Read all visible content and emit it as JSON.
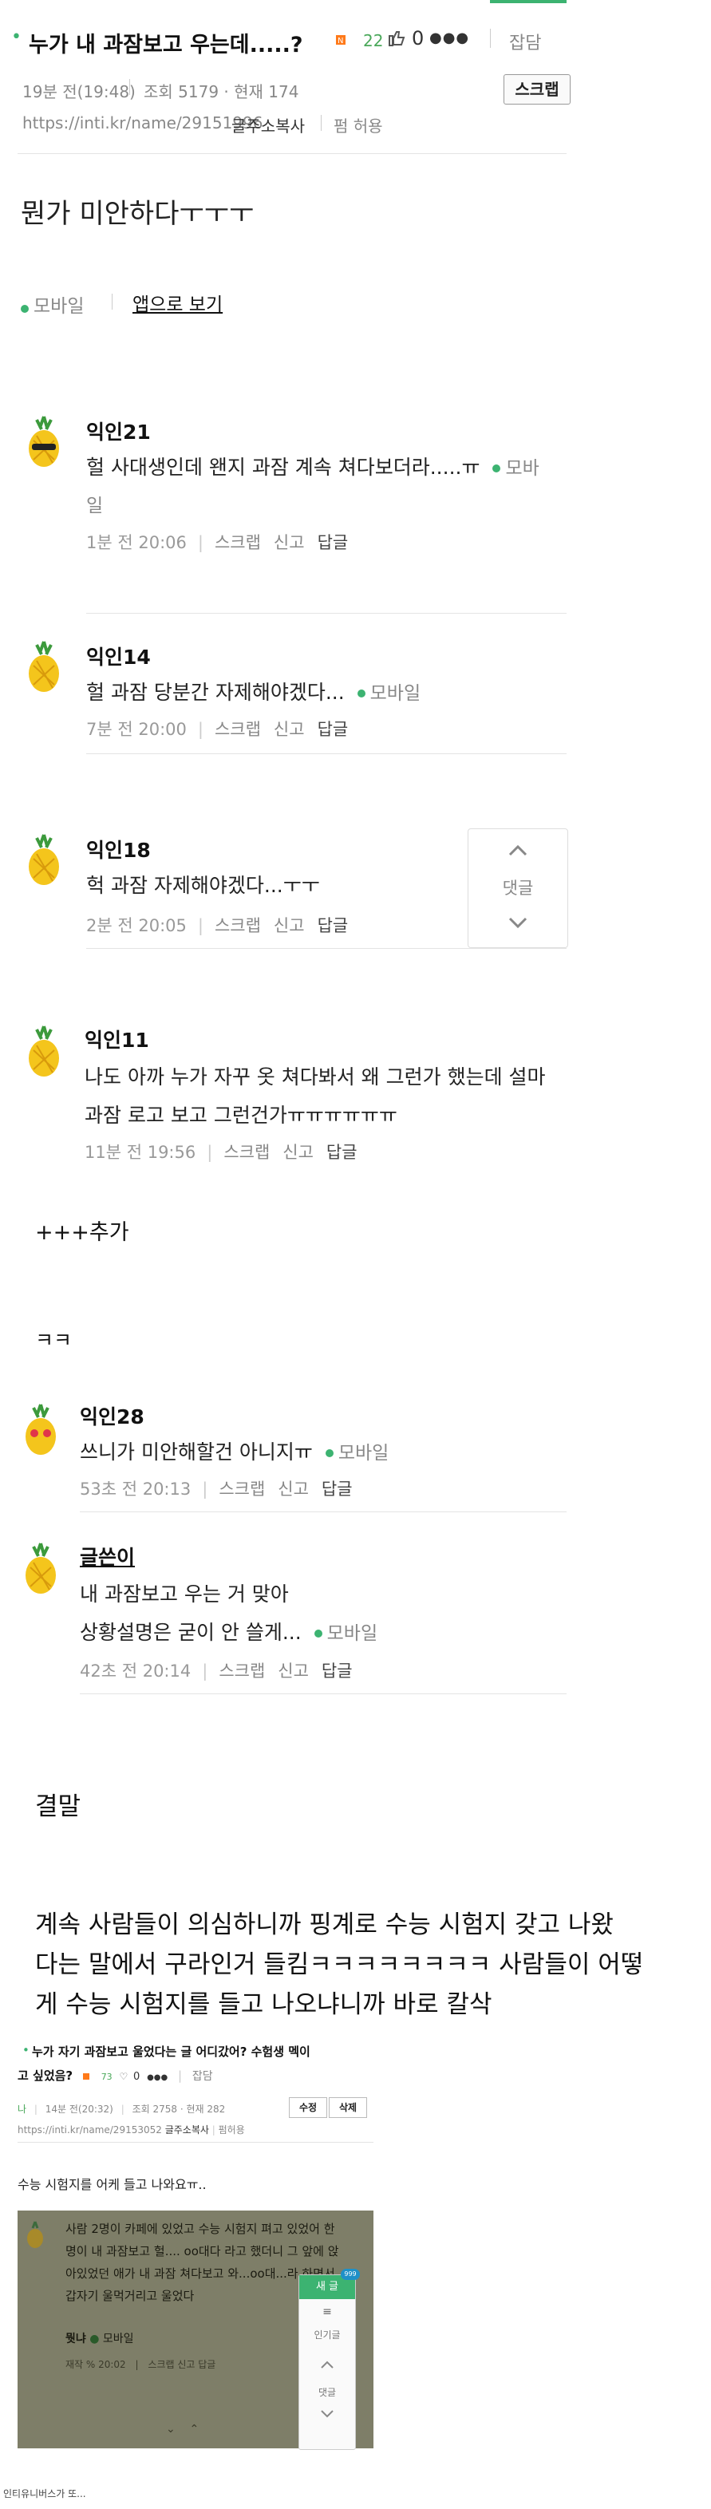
{
  "post": {
    "bullet": "•",
    "title": "누가 내 과잠보고 우는데.....?",
    "likes": "22",
    "zero": "0",
    "more": "●●●",
    "category": "잡담",
    "time": "19분 전(19:48)",
    "views": "조회 5179 · 현재 174",
    "url": "https://inti.kr/name/29151996",
    "copy_addr": "글주소복사",
    "edit_perm": "펌 허용",
    "scrap": "스크랩",
    "body": "뭔가 미안하다ㅜㅜㅜ",
    "mobile": "모바일",
    "app_view": "앱으로 보기"
  },
  "comments": [
    {
      "name": "익인21",
      "line1": "헐 사대생인데 왠지 과잠 계속 쳐다보더라.....ㅠ",
      "mobile": "모바",
      "line2": "일",
      "time": "1분 전 20:06"
    },
    {
      "name": "익인14",
      "line1": "헐 과잠 당분간 자제해야겠다...",
      "mobile": "모바일",
      "time": "7분 전 20:00"
    },
    {
      "name": "익인18",
      "line1": "헉 과잠 자제해야겠다...ㅜㅜ",
      "time": "2분 전 20:05"
    },
    {
      "name": "익인11",
      "line1": "나도 아까 누가 자꾸 옷 쳐다봐서 왜 그런가 했는데 설마",
      "line2": "과잠 로고 보고 그런건가ㅠㅠㅠㅠㅠㅠ",
      "time": "11분 전 19:56"
    },
    {
      "name": "익인28",
      "line1": "쓰니가 미안해할건 아니지ㅠ",
      "mobile": "모바일",
      "time": "53초 전 20:13"
    },
    {
      "name": "글쓴이",
      "line1": "내 과잠보고 우는 거 맞아",
      "line2": "상황설명은 굳이 안 쓸게...",
      "mobile": "모바일",
      "time": "42초 전 20:14"
    }
  ],
  "comment_actions": {
    "scrap": "스크랩",
    "report": "신고",
    "reply": "답글"
  },
  "float_nav": {
    "comment": "댓글"
  },
  "extra": {
    "added": "+++추가",
    "kk": "ㅋㅋ",
    "ending": "결말",
    "para1": "계속 사람들이 의심하니까 핑계로 수능 시험지 갖고 나왔",
    "para2": "다는 말에서 구라인거 들킴ㅋㅋㅋㅋㅋㅋㅋㅋ 사람들이 어떻",
    "para3": "게 수능 시험지를 들고 나오냐니까 바로 칼삭"
  },
  "nested": {
    "title1": "누가 자기 과잠보고 울었다는 글 어디갔어? 수험생 멕이",
    "title2": "고 싶었음?",
    "likes": "73",
    "zero": "0",
    "category": "잡담",
    "me": "나",
    "time": "14분 전(20:32)",
    "views": "조회 2758 · 현재 282",
    "url": "https://inti.kr/name/29153052",
    "copy_addr": "글주소복사",
    "edit_perm": "펌허용",
    "edit": "수정",
    "delete": "삭제",
    "body": "수능 시험지를 어케 들고 나와요ㅠ..",
    "q1": "사람 2명이 카페에 있었고 수능 시험지 펴고 있었어 한",
    "q2": "명이 내 과잠보고 헐.... oo대다 라고 했더니 그 앞에 앉",
    "q3": "아있었던 애가 내 과잠 쳐다보고 와...oo대...라 하면서",
    "q4": "갑자기 울먹거리고 울었다",
    "q_user": "뭣냐",
    "q_mobile": "모바일",
    "q_time": "재작 % 20:02",
    "q_actions": "스크랩 신고 답글",
    "new_btn": "새 글",
    "new_count": "999",
    "menu_glyph": "≡",
    "popular": "인기글",
    "comment": "댓글"
  },
  "footer": "인티유니버스가 또..."
}
